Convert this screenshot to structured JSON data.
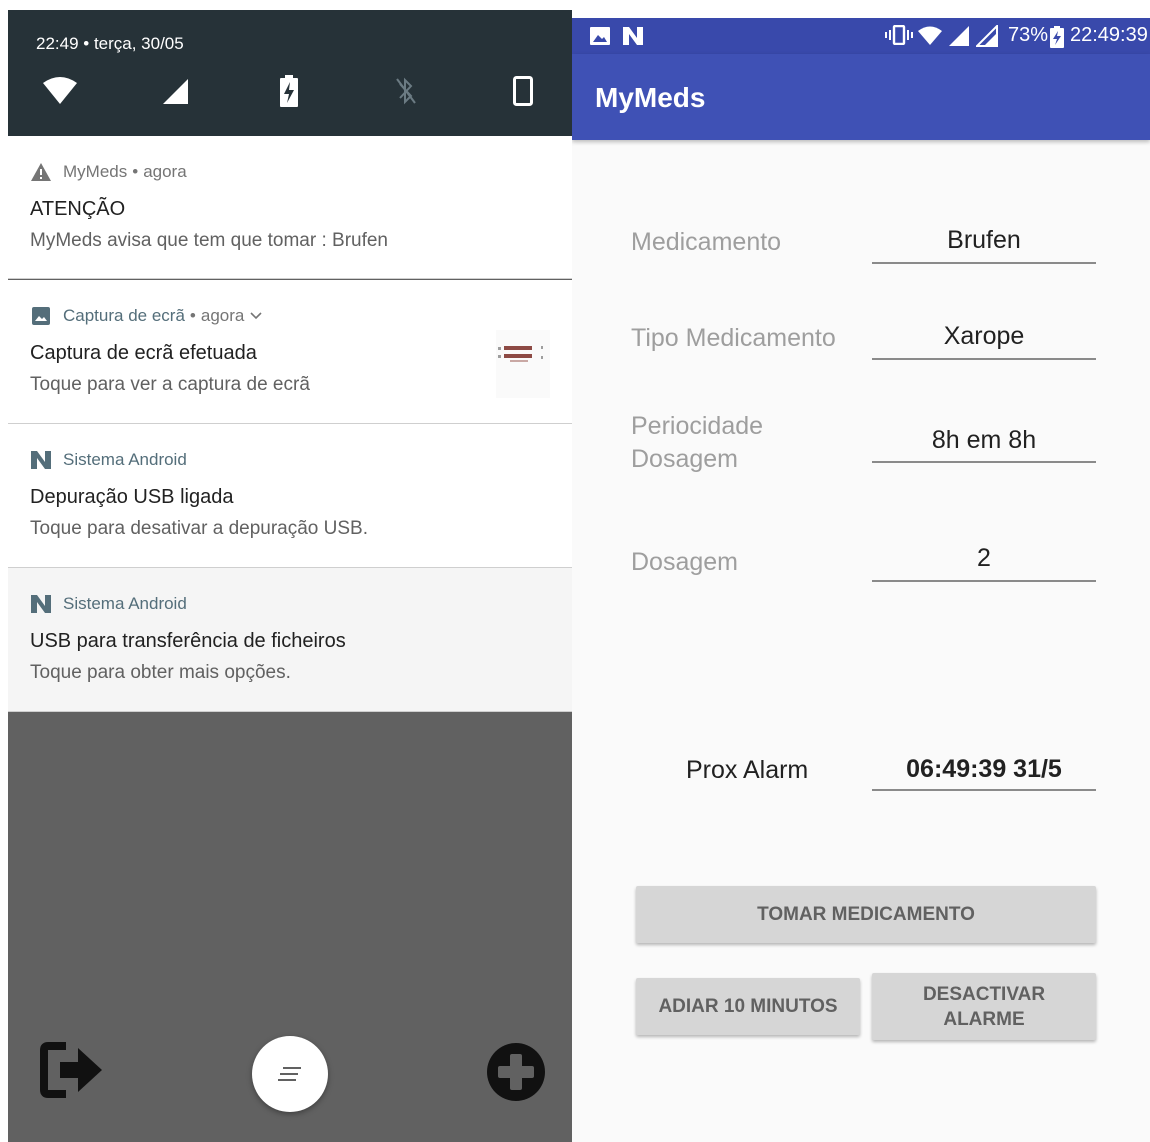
{
  "shade": {
    "datetime": "22:49 • terça, 30/05",
    "quick_tiles": [
      "wifi-icon",
      "cell-signal-icon",
      "battery-charging-icon",
      "bluetooth-off-icon",
      "phone-rotation-icon"
    ],
    "notifications": [
      {
        "app": "MyMeds",
        "time": "agora",
        "title": "ATENÇÃO",
        "text": "MyMeds avisa que tem que tomar : Brufen",
        "icon": "warning-icon"
      },
      {
        "app": "Captura de ecrã",
        "time": "agora",
        "title": "Captura de ecrã efetuada",
        "text": "Toque para ver a captura de ecrã",
        "icon": "image-icon"
      },
      {
        "app": "Sistema Android",
        "title": "Depuração USB ligada",
        "text": "Toque para desativar a depuração USB.",
        "icon": "android-n-icon"
      },
      {
        "app": "Sistema Android",
        "title": "USB para transferência de ficheiros",
        "text": "Toque para obter mais opções.",
        "icon": "android-n-icon"
      }
    ],
    "dock_icons": [
      "exit-icon",
      "notes-icon",
      "add-icon"
    ]
  },
  "status_bar": {
    "battery": "73%",
    "time": "22:49:39",
    "icons": [
      "gallery-icon",
      "android-n-icon",
      "vibrate-icon",
      "wifi-icon",
      "cell-signal-icon",
      "battery-charging-icon"
    ]
  },
  "app": {
    "title": "MyMeds",
    "colors": {
      "primary": "#3f51b5",
      "primary_dark": "#3949ab"
    },
    "fields": {
      "medicamento": {
        "label": "Medicamento",
        "value": "Brufen"
      },
      "tipo": {
        "label": "Tipo Medicamento",
        "value": "Xarope"
      },
      "periodicidade": {
        "label_line1": "Periocidade",
        "label_line2": "Dosagem",
        "value": "8h em 8h"
      },
      "dosagem": {
        "label": "Dosagem",
        "value": "2"
      }
    },
    "alarm": {
      "label": "Prox Alarm",
      "value": "06:49:39 31/5"
    },
    "buttons": {
      "tomar": "TOMAR MEDICAMENTO",
      "adiar": "ADIAR 10 MINUTOS",
      "desactivar_line1": "DESACTIVAR",
      "desactivar_line2": "ALARME"
    }
  }
}
